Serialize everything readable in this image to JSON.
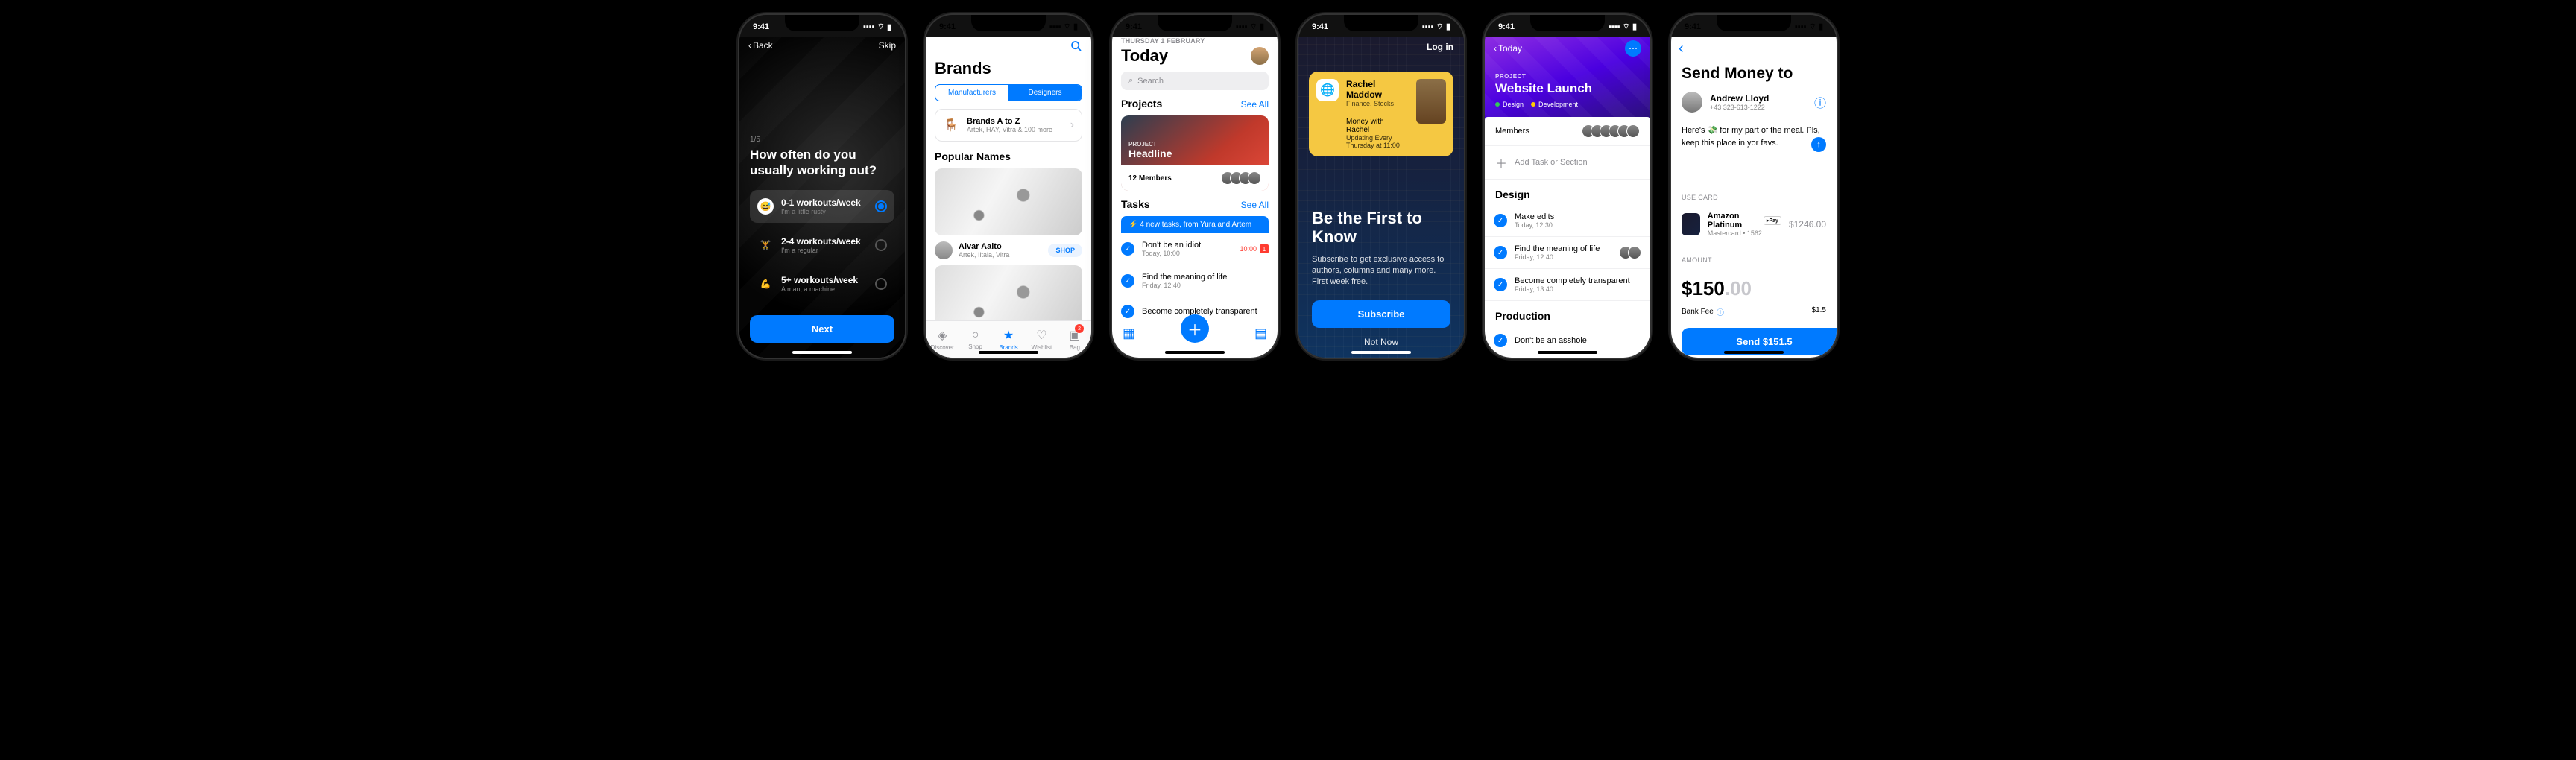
{
  "common": {
    "time": "9:41"
  },
  "p1": {
    "back": "Back",
    "skip": "Skip",
    "step": "1/5",
    "question": "How often do you usually working out?",
    "options": [
      {
        "title": "0-1 workouts/week",
        "sub": "I'm a little rusty",
        "selected": true,
        "icon": "😅"
      },
      {
        "title": "2-4 workouts/week",
        "sub": "I'm a regular",
        "selected": false,
        "icon": "🏋"
      },
      {
        "title": "5+ workouts/week",
        "sub": "A man, a machine",
        "selected": false,
        "icon": "💪"
      }
    ],
    "next": "Next"
  },
  "p2": {
    "title": "Brands",
    "seg": {
      "left": "Manufacturers",
      "right": "Designers"
    },
    "az": {
      "title": "Brands A to Z",
      "sub": "Artek, HAY, Vitra & 100 more"
    },
    "popular": "Popular Names",
    "brand": {
      "name": "Alvar Aalto",
      "sub": "Artek, Iitala, Vitra",
      "action": "SHOP"
    },
    "tabs": [
      {
        "label": "Discover",
        "icon": "◈"
      },
      {
        "label": "Shop",
        "icon": "○"
      },
      {
        "label": "Brands",
        "icon": "★",
        "active": true
      },
      {
        "label": "Wishlist",
        "icon": "♡"
      },
      {
        "label": "Bag",
        "icon": "▣",
        "badge": "2"
      }
    ]
  },
  "p3": {
    "date": "THURSDAY 1 FEBRUARY",
    "title": "Today",
    "search": "Search",
    "projects": "Projects",
    "seeall": "See All",
    "hero": {
      "label": "PROJECT",
      "title": "Headline",
      "members": "12 Members"
    },
    "tasks": "Tasks",
    "banner": "⚡ 4 new tasks, from Yura and Artem",
    "items": [
      {
        "title": "Don't be an idiot",
        "sub": "Today, 10:00",
        "time": "10:00",
        "badge": "1"
      },
      {
        "title": "Find the meaning of life",
        "sub": "Friday, 12:40"
      },
      {
        "title": "Become completely transparent",
        "sub": ""
      }
    ]
  },
  "p4": {
    "login": "Log in",
    "card": {
      "name": "Rachel Maddow",
      "tags": "Finance, Stocks",
      "show": "Money with Rachel",
      "sched": "Updating Every Thursday at 11:00"
    },
    "headline": "Be the First to Know",
    "body": "Subscribe to get exclusive access to authors, columns and many more. First week free.",
    "cta": "Subscribe",
    "notnow": "Not Now"
  },
  "p5": {
    "back": "Today",
    "label": "PROJECT",
    "title": "Website Launch",
    "tags": [
      {
        "color": "#34c759",
        "label": "Design"
      },
      {
        "color": "#ffcc00",
        "label": "Development"
      }
    ],
    "members": "Members",
    "add": "Add Task or Section",
    "design": "Design",
    "tasks": [
      {
        "title": "Make edits",
        "sub": "Today, 12:30"
      },
      {
        "title": "Find the meaning of life",
        "sub": "Friday, 12:40",
        "avatars": true
      },
      {
        "title": "Become completely transparent",
        "sub": "Friday, 13:40"
      }
    ],
    "production": "Production",
    "prod_task": "Don't be an asshole"
  },
  "p6": {
    "title": "Send Money to",
    "contact": {
      "name": "Andrew Lloyd",
      "phone": "+43 323-613-1222"
    },
    "note": "Here's 💸 for my part of the meal. Pls, keep this place in yor favs.",
    "usecard": "USE CARD",
    "card": {
      "name": "Amazon Platinum",
      "pay": "▸Pay",
      "sub": "Mastercard • 1562",
      "amount": "$1246.00"
    },
    "amount_lbl": "AMOUNT",
    "amount_main": "$150",
    "amount_dec": ".00",
    "fee_lbl": "Bank Fee",
    "fee_amt": "$1.5",
    "send": "Send $151.5"
  }
}
